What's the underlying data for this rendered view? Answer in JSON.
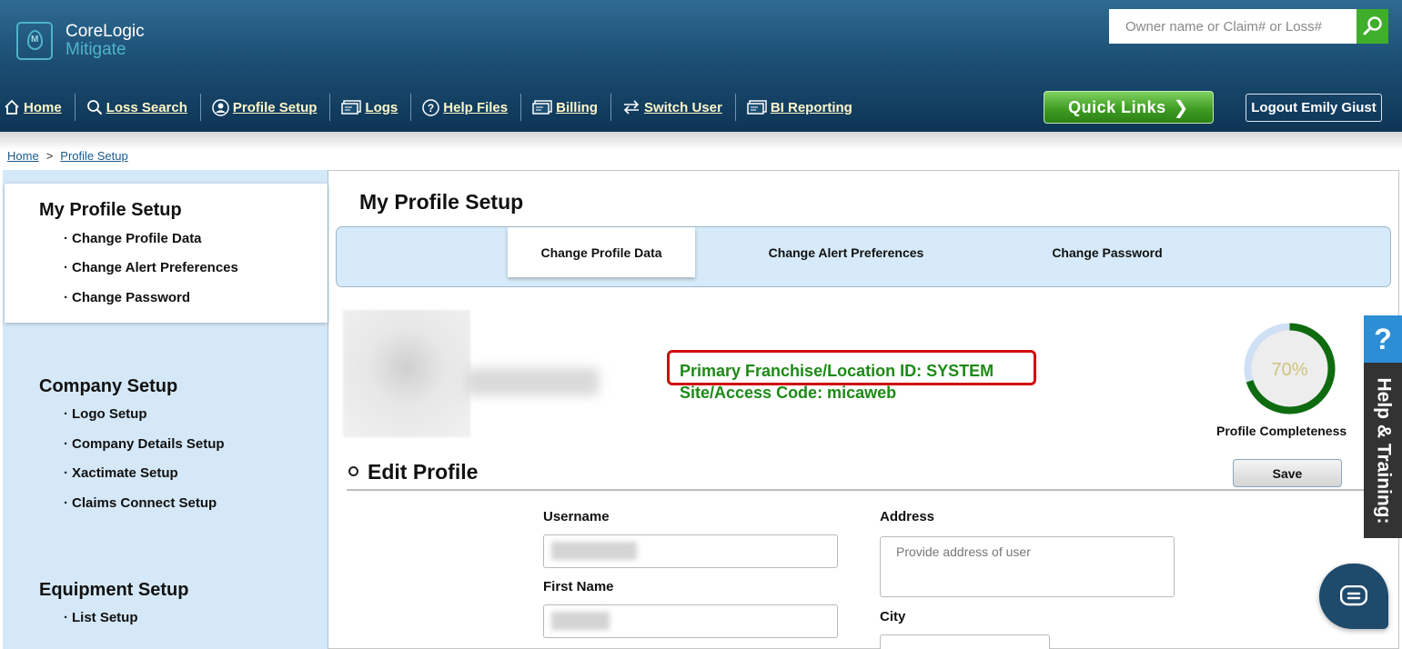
{
  "header": {
    "brand_line1": "CoreLogic",
    "brand_line2": "Mitigate",
    "search_placeholder": "Owner name or Claim# or Loss#",
    "quick_links_label": "Quick Links",
    "logout_label": "Logout Emily Giust"
  },
  "nav": {
    "items": [
      {
        "label": "Home",
        "icon": "home-icon"
      },
      {
        "label": "Loss Search",
        "icon": "search-icon"
      },
      {
        "label": "Profile Setup",
        "icon": "user-icon"
      },
      {
        "label": "Logs",
        "icon": "card-icon"
      },
      {
        "label": "Help Files",
        "icon": "question-icon"
      },
      {
        "label": "Billing",
        "icon": "card-icon"
      },
      {
        "label": "Switch User",
        "icon": "swap-icon"
      },
      {
        "label": "BI Reporting",
        "icon": "card-icon"
      }
    ]
  },
  "breadcrumb": {
    "home": "Home",
    "separator": ">",
    "current": "Profile Setup"
  },
  "sidebar": {
    "sections": [
      {
        "title": "My Profile Setup",
        "links": [
          "Change Profile Data",
          "Change Alert Preferences",
          "Change Password"
        ]
      },
      {
        "title": "Company Setup",
        "links": [
          "Logo Setup",
          "Company Details Setup",
          "Xactimate Setup",
          "Claims Connect Setup"
        ]
      },
      {
        "title": "Equipment Setup",
        "links": [
          "List Setup"
        ]
      }
    ]
  },
  "main": {
    "title": "My Profile Setup",
    "tabs": [
      {
        "label": "Change Profile Data",
        "active": true
      },
      {
        "label": "Change Alert Preferences",
        "active": false
      },
      {
        "label": "Change Password",
        "active": false
      }
    ],
    "franchise_line": "Primary Franchise/Location ID: SYSTEM",
    "site_line": "Site/Access Code: micaweb",
    "completeness": {
      "percent_label": "70%",
      "fraction": 0.7,
      "label": "Profile Completeness"
    },
    "edit_profile_title": "Edit Profile",
    "save_label": "Save",
    "fields": {
      "username_label": "Username",
      "first_name_label": "First Name",
      "address_label": "Address",
      "address_placeholder": "Provide address of user",
      "city_label": "City"
    }
  },
  "help": {
    "question_mark": "?",
    "label": "Help & Training:"
  },
  "colors": {
    "header_dark": "#0e3556",
    "accent_green": "#3fae2a",
    "franchise_text": "#1d8a16",
    "highlight_red": "#d00d0d",
    "sidebar_bg": "#d5e8f7",
    "progress_green": "#0f6b0f",
    "progress_remaining": "#cfe0f5"
  }
}
